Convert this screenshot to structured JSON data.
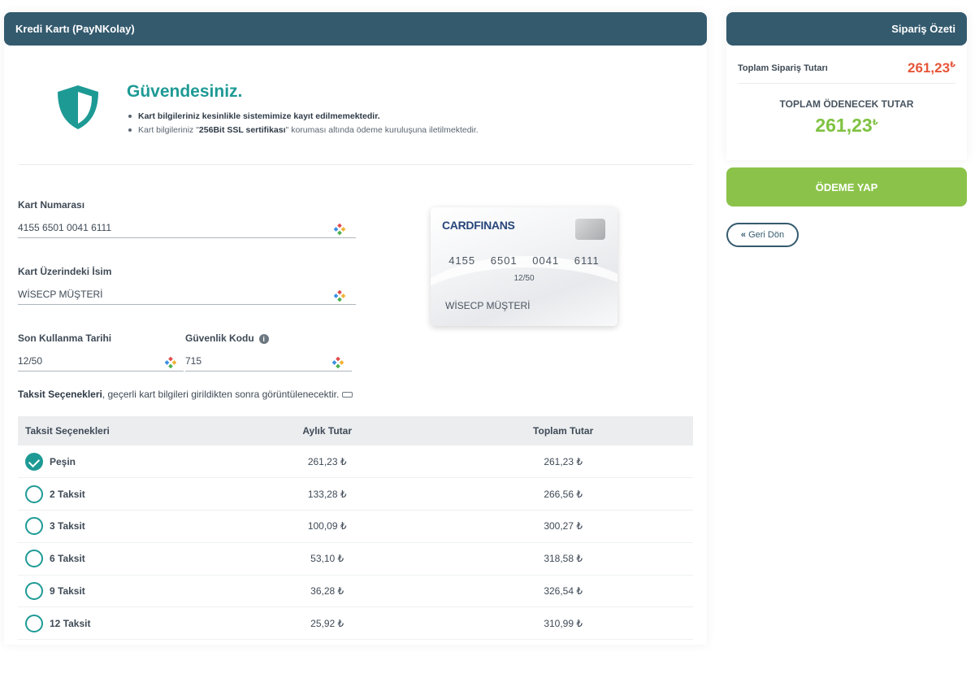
{
  "payment_panel": {
    "title": "Kredi Kartı (PayNKolay)",
    "secure": {
      "title": "Güvendesiniz.",
      "line1": "Kart bilgileriniz kesinlikle sistemimize kayıt edilmemektedir.",
      "line2_prefix": "Kart bilgileriniz \"",
      "line2_bold": "256Bit SSL sertifikası",
      "line2_suffix": "\" koruması altında ödeme kuruluşuna iletilmektedir."
    },
    "fields": {
      "card_number": {
        "label": "Kart Numarası",
        "value": "4155 6501 0041 6111"
      },
      "card_name": {
        "label": "Kart Üzerindeki İsim",
        "value": "WİSECP MÜŞTERİ"
      },
      "expiry": {
        "label": "Son Kullanma Tarihi",
        "value": "12/50"
      },
      "cvv": {
        "label": "Güvenlik Kodu",
        "value": "715"
      }
    },
    "card_preview": {
      "brand": "CARDFINANS",
      "number_groups": "4155 6501 0041 6111",
      "expiry": "12/50",
      "holder": "WİSECP MÜŞTERİ"
    },
    "installment_note": {
      "bold": "Taksit Seçenekleri",
      "text": ", geçerli kart bilgileri girildikten sonra görüntülenecektir."
    },
    "installments": {
      "headers": [
        "Taksit Seçenekleri",
        "Aylık Tutar",
        "Toplam Tutar"
      ],
      "rows": [
        {
          "label": "Peşin",
          "monthly": "261,23 ₺",
          "total": "261,23 ₺",
          "selected": true
        },
        {
          "label": "2 Taksit",
          "monthly": "133,28 ₺",
          "total": "266,56 ₺",
          "selected": false
        },
        {
          "label": "3 Taksit",
          "monthly": "100,09 ₺",
          "total": "300,27 ₺",
          "selected": false
        },
        {
          "label": "6 Taksit",
          "monthly": "53,10 ₺",
          "total": "318,58 ₺",
          "selected": false
        },
        {
          "label": "9 Taksit",
          "monthly": "36,28 ₺",
          "total": "326,54 ₺",
          "selected": false
        },
        {
          "label": "12 Taksit",
          "monthly": "25,92 ₺",
          "total": "310,99 ₺",
          "selected": false
        }
      ]
    }
  },
  "order_summary": {
    "title": "Sipariş Özeti",
    "order_total_label": "Toplam Sipariş Tutarı",
    "order_total_value": "261,23",
    "payable_label": "TOPLAM ÖDENECEK TUTAR",
    "payable_value": "261,23",
    "currency": "₺"
  },
  "actions": {
    "pay_label": "ÖDEME YAP",
    "back_label": "Geri Dön"
  },
  "colors": {
    "header": "#345a6e",
    "teal": "#1e9a95",
    "pay_green": "#8bc34a",
    "total_green": "#7fc242",
    "order_red": "#e7563a"
  }
}
